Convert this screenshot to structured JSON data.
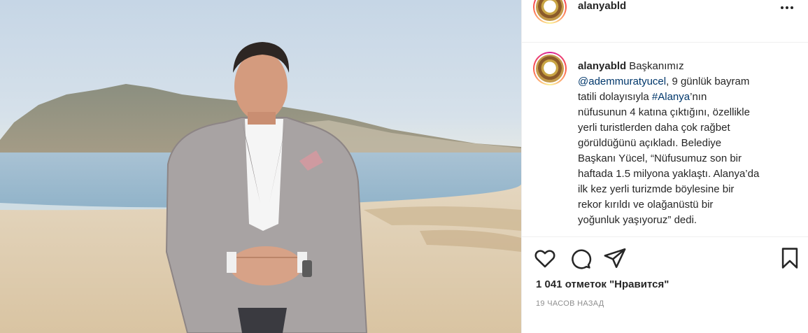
{
  "post": {
    "username": "alanyabld",
    "caption": {
      "username": "alanyabld",
      "segments": [
        {
          "text": "Başkanımız",
          "type": "text"
        },
        {
          "text": "@ademmuratyucel",
          "type": "mention"
        },
        {
          "text": ", 9 günlük bayram",
          "type": "text"
        },
        {
          "text": "tatili dolayısıyla ",
          "type": "text"
        },
        {
          "text": "#Alanya",
          "type": "hashtag"
        },
        {
          "text": "’nın",
          "type": "text"
        },
        {
          "text": "nüfusunun 4 katına çıktığını, özellikle",
          "type": "text"
        },
        {
          "text": "yerli turistlerden daha çok rağbet",
          "type": "text"
        },
        {
          "text": "görüldüğünü açıkladı. Belediye",
          "type": "text"
        },
        {
          "text": "Başkanı Yücel, “Nüfusumuz son bir",
          "type": "text"
        },
        {
          "text": "haftada 1.5 milyona yaklaştı. Alanya’da",
          "type": "text"
        },
        {
          "text": "ilk kez yerli turizmde böylesine bir",
          "type": "text"
        },
        {
          "text": "rekor kırıldı ve olağanüstü bir",
          "type": "text"
        },
        {
          "text": "yoğunluk yaşıyoruz” dedi.",
          "type": "text"
        }
      ]
    },
    "likes_text": "1 041 отметок \"Нравится\"",
    "time_text": "19 ЧАСОВ НАЗАД"
  },
  "icons": {
    "like": "heart-icon",
    "comment": "comment-icon",
    "share": "share-icon",
    "save": "bookmark-icon",
    "more": "more-icon"
  },
  "colors": {
    "text": "#262626",
    "link": "#00376b",
    "muted": "#8e8e8e",
    "divider": "#efefef"
  }
}
